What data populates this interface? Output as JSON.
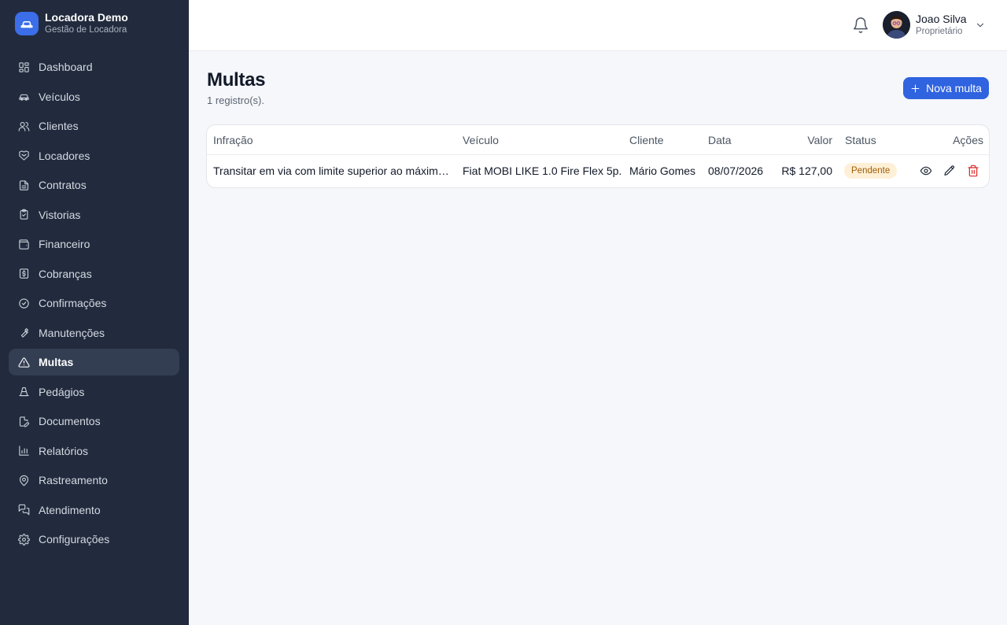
{
  "brand": {
    "name": "Locadora Demo",
    "subtitle": "Gestão de Locadora"
  },
  "sidebar": {
    "items": [
      {
        "label": "Dashboard",
        "icon": "dashboard-icon"
      },
      {
        "label": "Veículos",
        "icon": "car-icon"
      },
      {
        "label": "Clientes",
        "icon": "users-icon"
      },
      {
        "label": "Locadores",
        "icon": "handshake-icon"
      },
      {
        "label": "Contratos",
        "icon": "document-icon"
      },
      {
        "label": "Vistorias",
        "icon": "clipboard-check-icon"
      },
      {
        "label": "Financeiro",
        "icon": "wallet-icon"
      },
      {
        "label": "Cobranças",
        "icon": "receipt-icon"
      },
      {
        "label": "Confirmações",
        "icon": "check-circle-icon"
      },
      {
        "label": "Manutenções",
        "icon": "wrench-icon"
      },
      {
        "label": "Multas",
        "icon": "warning-icon",
        "active": true
      },
      {
        "label": "Pedágios",
        "icon": "cone-icon"
      },
      {
        "label": "Documentos",
        "icon": "file-edit-icon"
      },
      {
        "label": "Relatórios",
        "icon": "bar-chart-icon"
      },
      {
        "label": "Rastreamento",
        "icon": "map-pin-icon"
      },
      {
        "label": "Atendimento",
        "icon": "chat-icon"
      },
      {
        "label": "Configurações",
        "icon": "gear-icon"
      }
    ]
  },
  "header": {
    "user_name": "Joao Silva",
    "user_role": "Proprietário"
  },
  "page": {
    "title": "Multas",
    "count": "1 registro(s).",
    "new_button": "Nova multa"
  },
  "table": {
    "columns": [
      "Infração",
      "Veículo",
      "Cliente",
      "Data",
      "Valor",
      "Status",
      "Ações"
    ],
    "rows": [
      {
        "infracao": "Transitar em via com limite superior ao máximo permitido",
        "veiculo": "Fiat MOBI LIKE 1.0 Fire Flex 5p.",
        "cliente": "Mário Gomes",
        "data": "08/07/2026",
        "valor": "R$ 127,00",
        "status": "Pendente"
      }
    ]
  },
  "colors": {
    "sidebar_bg": "#222b3d",
    "accent": "#2f63e0",
    "status_pending_bg": "#fdf0d6",
    "status_pending_text": "#a15c07",
    "danger": "#dc2626"
  }
}
